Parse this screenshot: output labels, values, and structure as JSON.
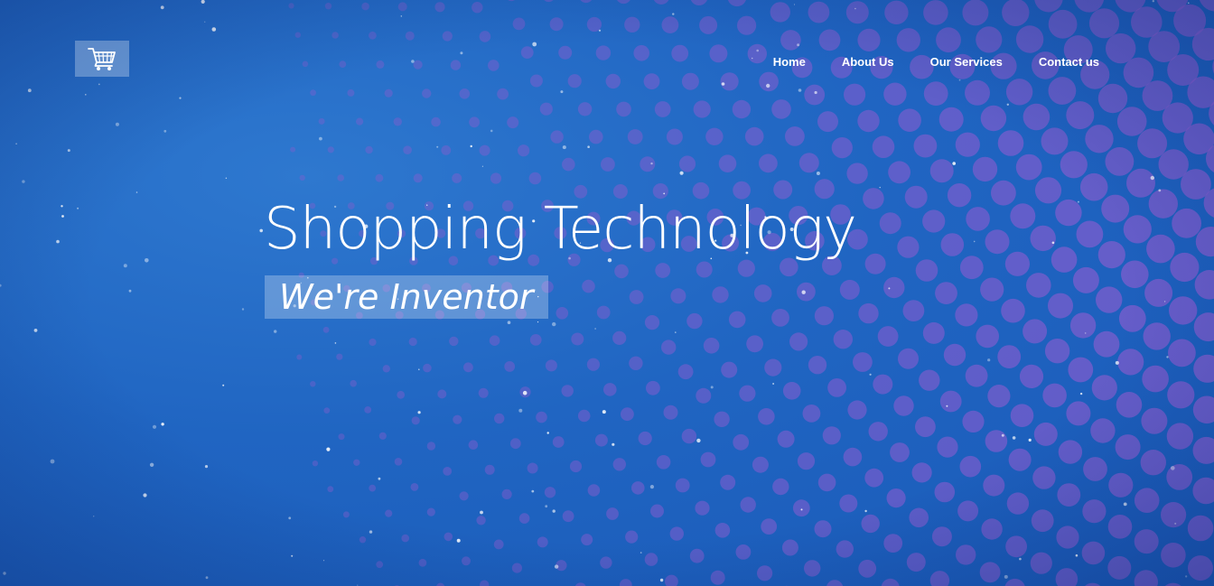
{
  "brand": {
    "logo_icon": "shopping-cart-icon"
  },
  "nav": {
    "items": [
      {
        "label": "Home"
      },
      {
        "label": "About Us"
      },
      {
        "label": "Our Services"
      },
      {
        "label": "Contact us"
      }
    ]
  },
  "hero": {
    "headline": "Shopping Technology",
    "tagline": "We're Inventor"
  },
  "colors": {
    "background": "#2065c2",
    "accent_dots": "#8a5ccf",
    "text": "#ffffff"
  }
}
